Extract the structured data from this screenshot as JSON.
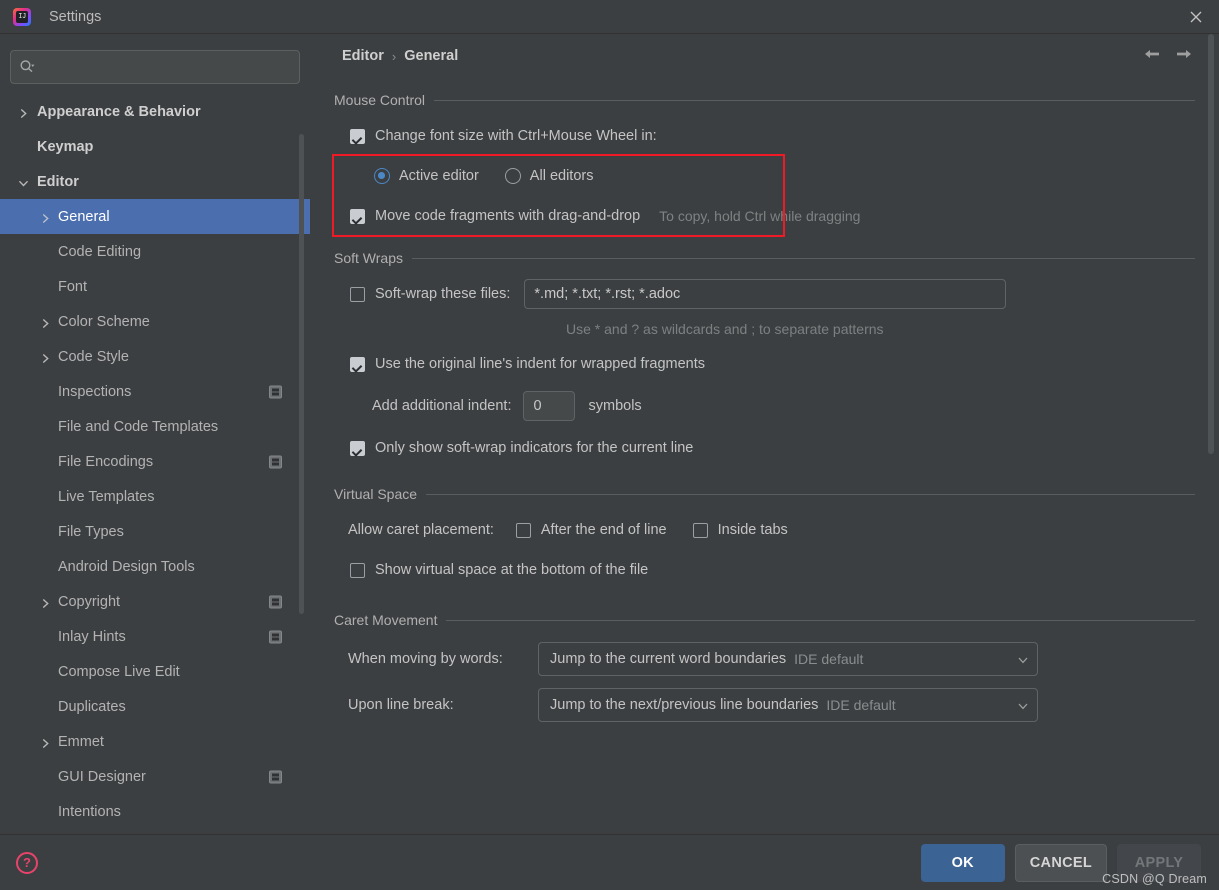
{
  "window": {
    "title": "Settings",
    "app_icon": "intellij-idea-logo",
    "close_icon": "close-icon"
  },
  "search": {
    "value": "",
    "placeholder": "",
    "icon": "search-icon"
  },
  "sidebar": {
    "items": [
      {
        "label": "Appearance & Behavior",
        "level": 0,
        "chevron": "chevron-right",
        "bold": true,
        "badge": false,
        "selected": false
      },
      {
        "label": "Keymap",
        "level": 0,
        "chevron": "none",
        "bold": true,
        "badge": false,
        "selected": false
      },
      {
        "label": "Editor",
        "level": 0,
        "chevron": "chevron-down",
        "bold": true,
        "badge": false,
        "selected": false
      },
      {
        "label": "General",
        "level": 1,
        "chevron": "chevron-right",
        "bold": false,
        "badge": false,
        "selected": true
      },
      {
        "label": "Code Editing",
        "level": 1,
        "chevron": "none",
        "bold": false,
        "badge": false,
        "selected": false
      },
      {
        "label": "Font",
        "level": 1,
        "chevron": "none",
        "bold": false,
        "badge": false,
        "selected": false
      },
      {
        "label": "Color Scheme",
        "level": 1,
        "chevron": "chevron-right",
        "bold": false,
        "badge": false,
        "selected": false
      },
      {
        "label": "Code Style",
        "level": 1,
        "chevron": "chevron-right",
        "bold": false,
        "badge": false,
        "selected": false
      },
      {
        "label": "Inspections",
        "level": 1,
        "chevron": "none",
        "bold": false,
        "badge": true,
        "selected": false
      },
      {
        "label": "File and Code Templates",
        "level": 1,
        "chevron": "none",
        "bold": false,
        "badge": false,
        "selected": false
      },
      {
        "label": "File Encodings",
        "level": 1,
        "chevron": "none",
        "bold": false,
        "badge": true,
        "selected": false
      },
      {
        "label": "Live Templates",
        "level": 1,
        "chevron": "none",
        "bold": false,
        "badge": false,
        "selected": false
      },
      {
        "label": "File Types",
        "level": 1,
        "chevron": "none",
        "bold": false,
        "badge": false,
        "selected": false
      },
      {
        "label": "Android Design Tools",
        "level": 1,
        "chevron": "none",
        "bold": false,
        "badge": false,
        "selected": false
      },
      {
        "label": "Copyright",
        "level": 1,
        "chevron": "chevron-right",
        "bold": false,
        "badge": true,
        "selected": false
      },
      {
        "label": "Inlay Hints",
        "level": 1,
        "chevron": "none",
        "bold": false,
        "badge": true,
        "selected": false
      },
      {
        "label": "Compose Live Edit",
        "level": 1,
        "chevron": "none",
        "bold": false,
        "badge": false,
        "selected": false
      },
      {
        "label": "Duplicates",
        "level": 1,
        "chevron": "none",
        "bold": false,
        "badge": false,
        "selected": false
      },
      {
        "label": "Emmet",
        "level": 1,
        "chevron": "chevron-right",
        "bold": false,
        "badge": false,
        "selected": false
      },
      {
        "label": "GUI Designer",
        "level": 1,
        "chevron": "none",
        "bold": false,
        "badge": true,
        "selected": false
      },
      {
        "label": "Intentions",
        "level": 1,
        "chevron": "none",
        "bold": false,
        "badge": false,
        "selected": false
      }
    ]
  },
  "breadcrumb": {
    "parent": "Editor",
    "separator": "›",
    "current": "General",
    "back_icon": "arrow-left-icon",
    "forward_icon": "arrow-right-icon"
  },
  "sections": {
    "mouse_control": {
      "title": "Mouse Control",
      "change_font_size": {
        "label": "Change font size with Ctrl+Mouse Wheel in:",
        "checked": true
      },
      "scope_options": [
        {
          "label": "Active editor",
          "selected": true
        },
        {
          "label": "All editors",
          "selected": false
        }
      ],
      "drag_and_drop": {
        "label": "Move code fragments with drag-and-drop",
        "checked": true,
        "hint": "To copy, hold Ctrl while dragging"
      }
    },
    "soft_wraps": {
      "title": "Soft Wraps",
      "soft_wrap_files": {
        "label": "Soft-wrap these files:",
        "checked": false,
        "value": "*.md; *.txt; *.rst; *.adoc",
        "hint": "Use * and ? as wildcards and ; to separate patterns"
      },
      "original_indent": {
        "label": "Use the original line's indent for wrapped fragments",
        "checked": true
      },
      "additional_indent": {
        "label": "Add additional indent:",
        "value": "0",
        "unit": "symbols"
      },
      "only_current_line": {
        "label": "Only show soft-wrap indicators for the current line",
        "checked": true
      }
    },
    "virtual_space": {
      "title": "Virtual Space",
      "caret_placement_label": "Allow caret placement:",
      "caret_options": [
        {
          "label": "After the end of line",
          "checked": false
        },
        {
          "label": "Inside tabs",
          "checked": false
        }
      ],
      "show_virtual_space": {
        "label": "Show virtual space at the bottom of the file",
        "checked": false
      }
    },
    "caret_movement": {
      "title": "Caret Movement",
      "when_moving_by_words": {
        "label": "When moving by words:",
        "value": "Jump to the current word boundaries",
        "default_tag": "IDE default",
        "arrow_icon": "chevron-down-icon"
      },
      "upon_line_break": {
        "label": "Upon line break:",
        "value": "Jump to the next/previous line boundaries",
        "default_tag": "IDE default",
        "arrow_icon": "chevron-down-icon"
      }
    }
  },
  "footer": {
    "help_icon": "help-question-icon",
    "ok_label": "OK",
    "cancel_label": "CANCEL",
    "apply_label": "APPLY",
    "apply_enabled": false,
    "watermark": "CSDN @Q Dream"
  },
  "colors": {
    "window_bg": "#3c3f41",
    "selection_blue": "#4b6eaf",
    "primary_button": "#3b6394",
    "annotation_red": "#ef1a25",
    "accent_radio": "#4a88c7",
    "help_pink": "#e8436b"
  }
}
